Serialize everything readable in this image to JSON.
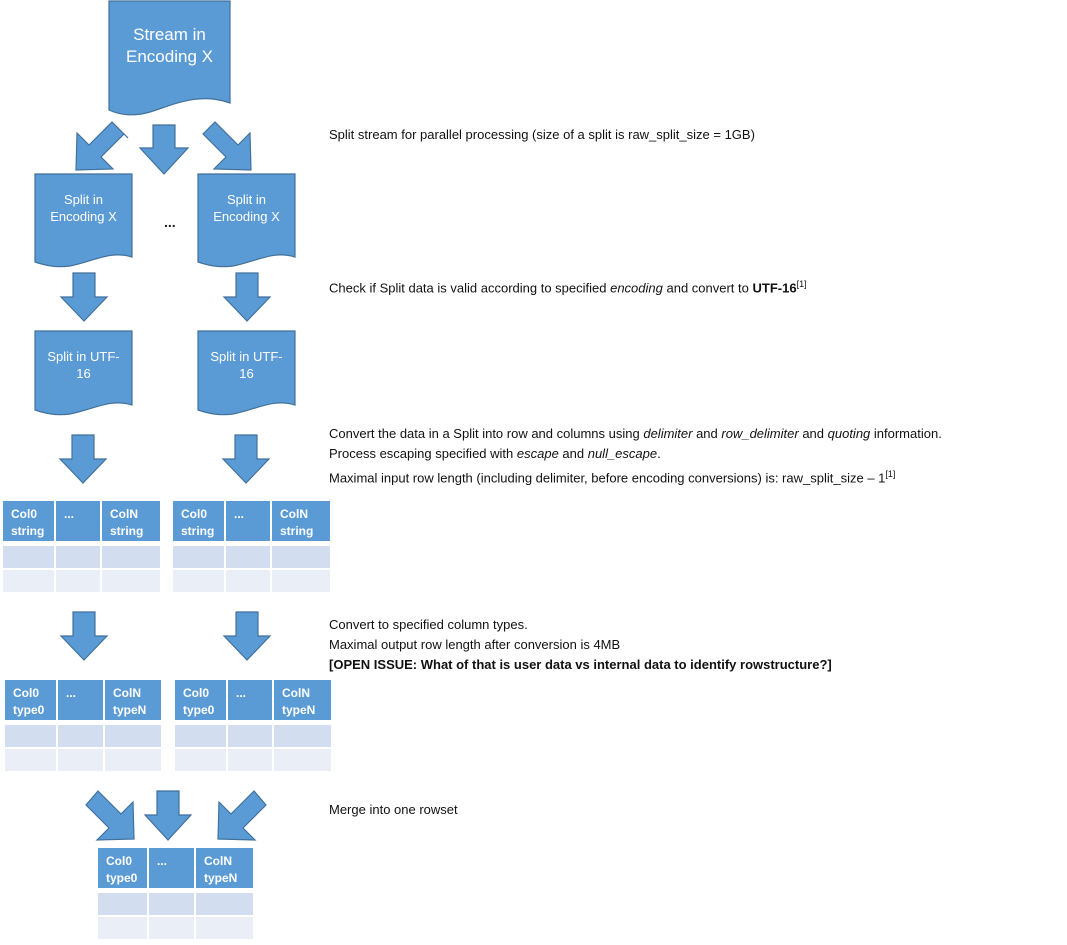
{
  "diagram": {
    "colors": {
      "shape_fill": "#5b9bd5",
      "shape_stroke": "#41719c",
      "header_fill": "#5b9bd5",
      "row_band_1": "#d2deef",
      "row_band_2": "#eaeff7",
      "text_on_shape": "#ffffff"
    },
    "stream_doc": {
      "line1": "Stream in",
      "line2": "Encoding X"
    },
    "split_docs": [
      {
        "line1": "Split in",
        "line2": "Encoding X"
      },
      {
        "line1": "Split in",
        "line2": "Encoding X"
      }
    ],
    "ellipsis": "...",
    "utf_docs": [
      {
        "line1": "Split in UTF-",
        "line2": "16"
      },
      {
        "line1": "Split in UTF-",
        "line2": "16"
      }
    ],
    "string_tables": [
      {
        "headers": [
          [
            "Col0",
            "string"
          ],
          [
            "...",
            ""
          ],
          [
            "ColN",
            "string"
          ]
        ]
      },
      {
        "headers": [
          [
            "Col0",
            "string"
          ],
          [
            "...",
            ""
          ],
          [
            "ColN",
            "string"
          ]
        ]
      }
    ],
    "typed_tables": [
      {
        "headers": [
          [
            "Col0",
            "type0"
          ],
          [
            "...",
            ""
          ],
          [
            "ColN",
            "typeN"
          ]
        ]
      },
      {
        "headers": [
          [
            "Col0",
            "type0"
          ],
          [
            "...",
            ""
          ],
          [
            "ColN",
            "typeN"
          ]
        ]
      }
    ],
    "merged_table": {
      "headers": [
        [
          "Col0",
          "type0"
        ],
        [
          "...",
          ""
        ],
        [
          "ColN",
          "typeN"
        ]
      ]
    }
  },
  "notes": {
    "split": "Split stream for parallel processing (size of a split is raw_split_size = 1GB)",
    "check": {
      "a": "Check if Split data is valid according to specified ",
      "encoding": "encoding",
      "b": " and convert to ",
      "utf": "UTF-16",
      "ref": "[1]"
    },
    "convert": {
      "line1_a": "Convert the data in a Split into row and columns using ",
      "delimiter": "delimiter",
      "and1": " and ",
      "row_delimiter": "row_delimiter",
      "and2": " and ",
      "quoting": "quoting",
      "line1_b": " information.",
      "line2_a": "Process escaping specified with ",
      "escape": "escape",
      "and3": " and ",
      "null_escape": "null_escape",
      "line2_b": ".",
      "line3": "Maximal input row length (including delimiter, before encoding conversions) is: raw_split_size – 1",
      "ref": "[1]"
    },
    "types": {
      "line1": "Convert to specified column types.",
      "line2": "Maximal output row length after conversion is 4MB",
      "line3": "[OPEN ISSUE: What of that is user data vs internal data to identify rowstructure?]"
    },
    "merge": "Merge into one rowset"
  }
}
